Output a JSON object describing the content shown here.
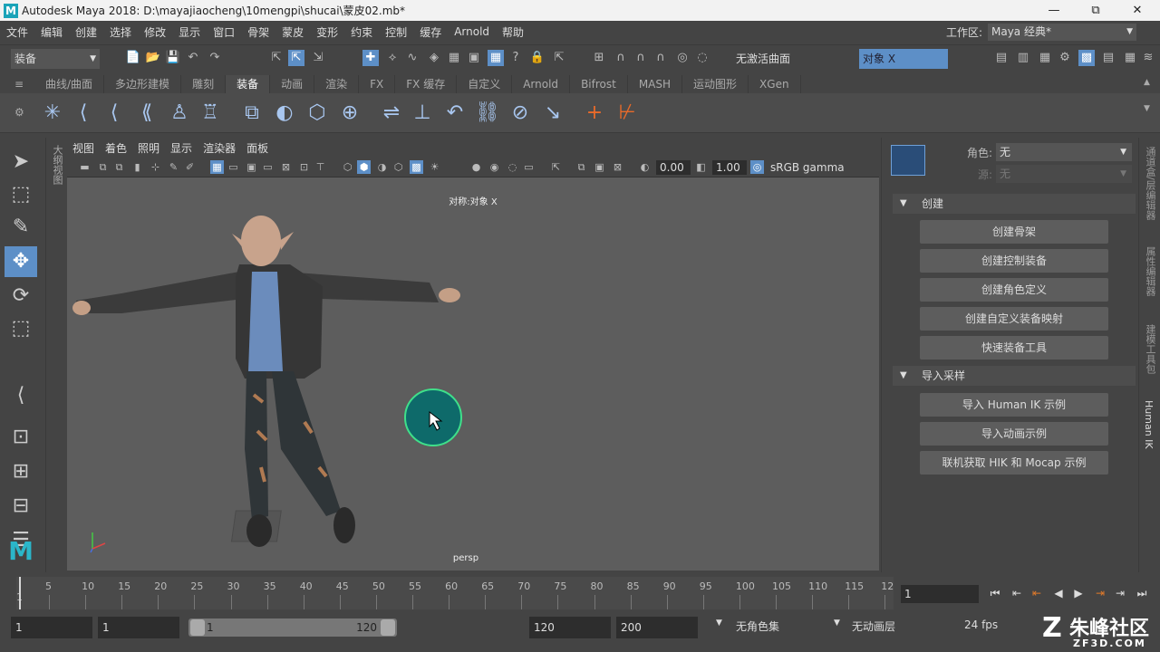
{
  "titlebar": {
    "title": "Autodesk Maya 2018: D:\\mayajiaocheng\\10mengpi\\shucai\\蒙皮02.mb*",
    "logo": "M",
    "minimize": "—",
    "maximize": "⧉",
    "close": "✕"
  },
  "menu": {
    "items": [
      "文件",
      "编辑",
      "创建",
      "选择",
      "修改",
      "显示",
      "窗口",
      "骨架",
      "蒙皮",
      "变形",
      "约束",
      "控制",
      "缓存",
      "Arnold",
      "帮助"
    ],
    "workspace_label": "工作区:",
    "workspace_value": "Maya 经典*"
  },
  "statusline": {
    "mode": "装备",
    "live_surface": "无激活曲面",
    "symmetry": "对象 X"
  },
  "shelf": {
    "tabs": [
      "曲线/曲面",
      "多边形建模",
      "雕刻",
      "装备",
      "动画",
      "渲染",
      "FX",
      "FX 缓存",
      "自定义",
      "Arnold",
      "Bifrost",
      "MASH",
      "运动图形",
      "XGen"
    ],
    "active_tab": "装备"
  },
  "outliner_strip": {
    "label": "大纲视图"
  },
  "panel": {
    "menus": [
      "视图",
      "着色",
      "照明",
      "显示",
      "渲染器",
      "面板"
    ],
    "exposure": "0.00",
    "gamma": "1.00",
    "colorspace": "sRGB gamma"
  },
  "viewport": {
    "symmetry_label": "对称:对象 X",
    "camera": "persp"
  },
  "hik": {
    "character_label": "角色:",
    "character_value": "无",
    "source_label": "源:",
    "source_value": "无",
    "section_create": "创建",
    "create_buttons": [
      "创建骨架",
      "创建控制装备",
      "创建角色定义",
      "创建自定义装备映射",
      "快速装备工具"
    ],
    "section_import": "导入采样",
    "import_buttons": [
      "导入 Human IK 示例",
      "导入动画示例",
      "联机获取 HIK 和 Mocap 示例"
    ]
  },
  "side_tabs": [
    "通道盒/层编辑器",
    "属性编辑器",
    "建模工具包",
    "Human IK"
  ],
  "timeline": {
    "ticks": [
      "5",
      "10",
      "15",
      "20",
      "25",
      "30",
      "35",
      "40",
      "45",
      "50",
      "55",
      "60",
      "65",
      "70",
      "75",
      "80",
      "85",
      "90",
      "95",
      "100",
      "105",
      "110",
      "115",
      "12"
    ],
    "first_tick": "1",
    "current_frame": "1"
  },
  "range": {
    "start": "1",
    "anim_start": "1",
    "slider_start": "1",
    "slider_end": "120",
    "anim_end": "120",
    "end": "200",
    "character_set": "无角色集",
    "anim_layer": "无动画层",
    "fps": "24 fps"
  },
  "watermark": {
    "text": "朱峰社区",
    "sub": "ZF3D.COM"
  }
}
